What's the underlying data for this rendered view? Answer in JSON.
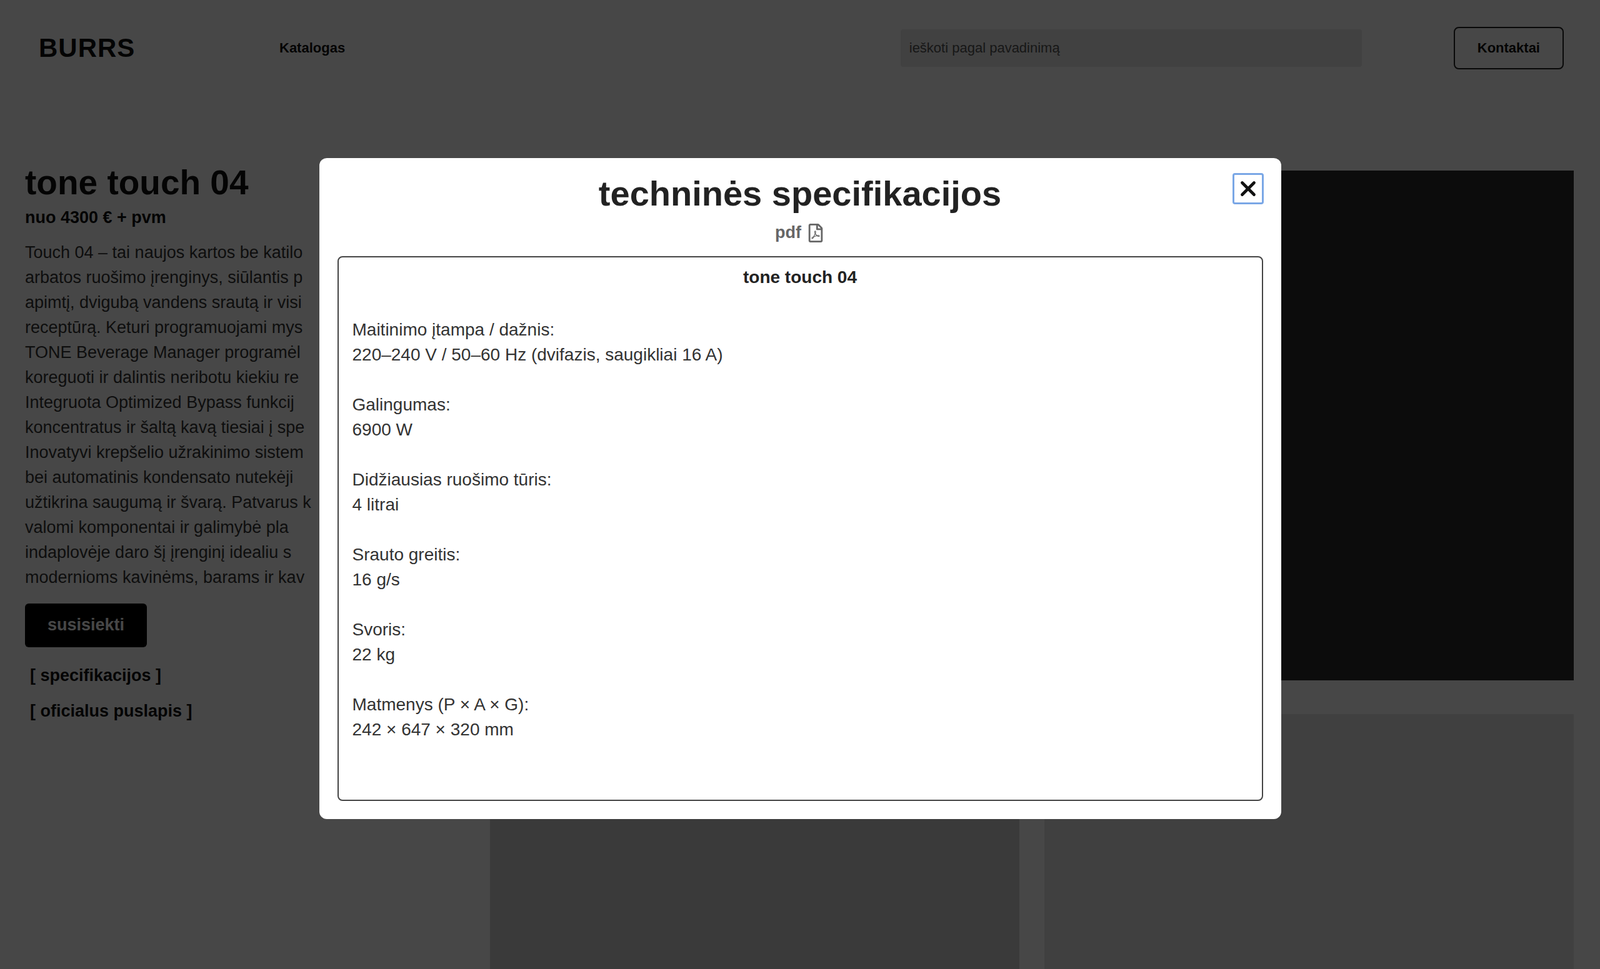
{
  "header": {
    "logo": "BURRS",
    "nav": [
      "Katalogas"
    ],
    "search": {
      "placeholder": "ieškoti pagal pavadinimą"
    },
    "button": "Kontaktai"
  },
  "product": {
    "title": "tone touch 04",
    "price": "nuo 4300 € + pvm",
    "description_lines": [
      "Touch 04 – tai naujos kartos be katilo",
      "arbatos ruošimo įrenginys, siūlantis p",
      "apimtį, dvigubą vandens srautą ir visi",
      "receptūrą. Keturi programuojami mys",
      "TONE Beverage Manager programėl",
      "koreguoti ir dalintis neribotu kiekiu re",
      "Integruota Optimized Bypass funkcij",
      "koncentratus ir šaltą kavą tiesiai į spe",
      "Inovatyvi krepšelio užrakinimo sistem",
      "bei automatinis kondensato nutekėji",
      "užtikrina saugumą ir švarą. Patvarus k",
      "valomi komponentai ir galimybė pla",
      "indaplovėje daro šį įrenginį idealiu s",
      "modernioms kavinėms, barams ir kav"
    ],
    "contact_button": "susisiekti",
    "links": [
      "[ specifikacijos ]",
      "[ oficialus puslapis ]"
    ]
  },
  "modal": {
    "title": "techninės specifikacijos",
    "pdf_label": "pdf",
    "close_button": {
      "focused": true
    },
    "sheet": {
      "title": "tone touch 04",
      "specs": [
        {
          "label": "Maitinimo įtampa / dažnis:",
          "value": "220–240 V / 50–60 Hz (dvifazis, saugikliai 16 A)"
        },
        {
          "label": "Galingumas:",
          "value": "6900 W"
        },
        {
          "label": "Didžiausias ruošimo tūris:",
          "value": "4 litrai"
        },
        {
          "label": "Srauto greitis:",
          "value": "16 g/s"
        },
        {
          "label": "Svoris:",
          "value": "22 kg"
        },
        {
          "label": "Matmenys (P × A × G):",
          "value": "242 × 647 × 320 mm"
        }
      ]
    }
  }
}
